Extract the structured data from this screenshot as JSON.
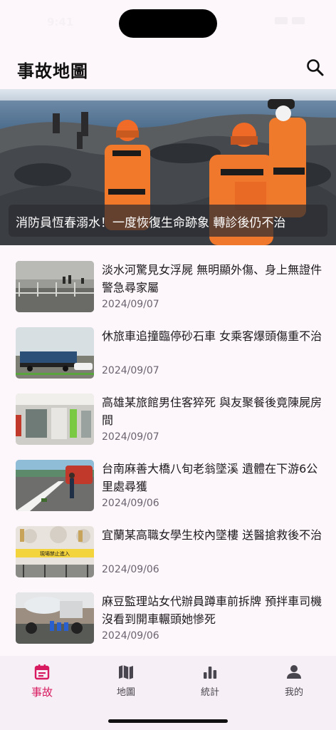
{
  "status_bar": {
    "time": "9:41"
  },
  "app_bar": {
    "title": "事故地圖",
    "search_icon": "search-icon"
  },
  "hero": {
    "caption": "消防員恆春溺水！一度恢復生命跡象 轉診後仍不治"
  },
  "news": [
    {
      "title": "淡水河驚見女浮屍 無明顯外傷、身上無證件 警急尋家屬",
      "date": "2024/09/07"
    },
    {
      "title": "休旅車追撞臨停砂石車 女乘客爆頭傷重不治",
      "date": "2024/09/07"
    },
    {
      "title": "高雄某旅館男住客猝死 與友聚餐後竟陳屍房間",
      "date": "2024/09/07"
    },
    {
      "title": "台南麻善大橋八旬老翁墜溪 遺體在下游6公里處尋獲",
      "date": "2024/09/06"
    },
    {
      "title": "宜蘭某高職女學生校內墜樓 送醫搶救後不治",
      "date": "2024/09/06"
    },
    {
      "title": "麻豆監理站女代辦員蹲車前拆牌 預拌車司機沒看到開車輾頭她慘死",
      "date": "2024/09/06"
    }
  ],
  "thumb_sign": "現場禁止進入",
  "bottom_nav": {
    "items": [
      {
        "label": "事故",
        "icon": "calendar-icon",
        "active": true
      },
      {
        "label": "地圖",
        "icon": "map-icon",
        "active": false
      },
      {
        "label": "統計",
        "icon": "bar-chart-icon",
        "active": false
      },
      {
        "label": "我的",
        "icon": "person-icon",
        "active": false
      }
    ]
  },
  "colors": {
    "accent": "#d81b60",
    "background": "#fdf7fb",
    "nav_background": "#f6eff5"
  }
}
